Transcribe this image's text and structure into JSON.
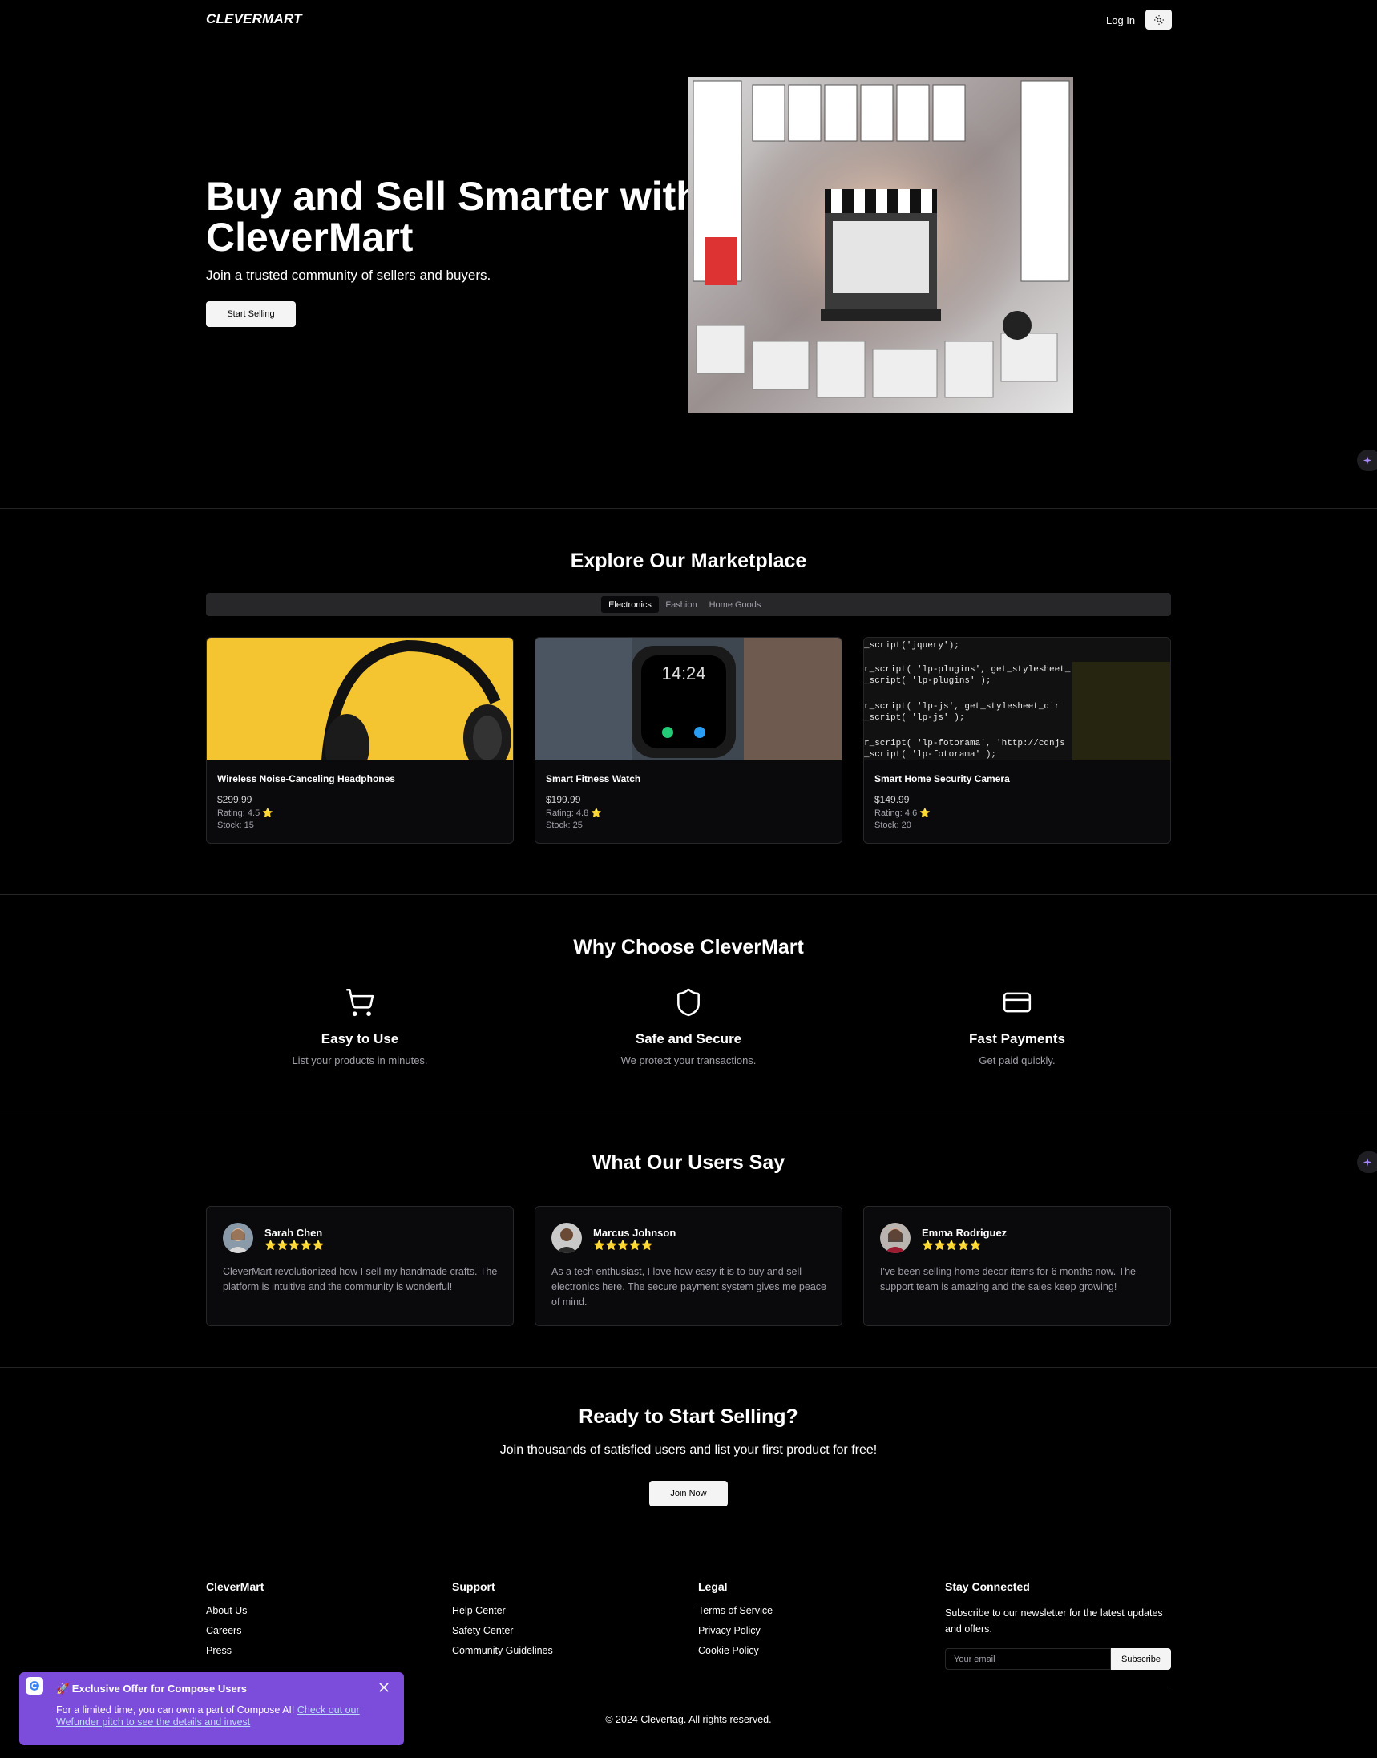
{
  "header": {
    "logo": "CLEVERMART",
    "login_label": "Log In",
    "theme_icon": "moon-sun-icon"
  },
  "hero": {
    "title": "Buy and Sell Smarter with CleverMart",
    "subtitle": "Join a trusted community of sellers and buyers.",
    "cta_label": "Start Selling"
  },
  "marketplace": {
    "title": "Explore Our Marketplace",
    "tabs": [
      {
        "label": "Electronics",
        "active": true
      },
      {
        "label": "Fashion",
        "active": false
      },
      {
        "label": "Home Goods",
        "active": false
      }
    ],
    "products": [
      {
        "name": "Wireless Noise-Canceling Headphones",
        "price": "$299.99",
        "rating": "Rating: 4.5 ⭐",
        "stock": "Stock: 15"
      },
      {
        "name": "Smart Fitness Watch",
        "price": "$199.99",
        "rating": "Rating: 4.8 ⭐",
        "stock": "Stock: 25"
      },
      {
        "name": "Smart Home Security Camera",
        "price": "$149.99",
        "rating": "Rating: 4.6 ⭐",
        "stock": "Stock: 20"
      }
    ]
  },
  "why": {
    "title": "Why Choose CleverMart",
    "features": [
      {
        "icon": "shopping-cart-icon",
        "title": "Easy to Use",
        "desc": "List your products in minutes."
      },
      {
        "icon": "shield-icon",
        "title": "Safe and Secure",
        "desc": "We protect your transactions."
      },
      {
        "icon": "credit-card-icon",
        "title": "Fast Payments",
        "desc": "Get paid quickly."
      }
    ]
  },
  "testimonials": {
    "title": "What Our Users Say",
    "items": [
      {
        "name": "Sarah Chen",
        "stars": "⭐⭐⭐⭐⭐",
        "text": "CleverMart revolutionized how I sell my handmade crafts. The platform is intuitive and the community is wonderful!"
      },
      {
        "name": "Marcus Johnson",
        "stars": "⭐⭐⭐⭐⭐",
        "text": "As a tech enthusiast, I love how easy it is to buy and sell electronics here. The secure payment system gives me peace of mind."
      },
      {
        "name": "Emma Rodriguez",
        "stars": "⭐⭐⭐⭐⭐",
        "text": "I've been selling home decor items for 6 months now. The support team is amazing and the sales keep growing!"
      }
    ]
  },
  "cta": {
    "title": "Ready to Start Selling?",
    "subtitle": "Join thousands of satisfied users and list your first product for free!",
    "button": "Join Now"
  },
  "footer": {
    "col1": {
      "heading": "CleverMart",
      "links": [
        "About Us",
        "Careers",
        "Press"
      ]
    },
    "col2": {
      "heading": "Support",
      "links": [
        "Help Center",
        "Safety Center",
        "Community Guidelines"
      ]
    },
    "col3": {
      "heading": "Legal",
      "links": [
        "Terms of Service",
        "Privacy Policy",
        "Cookie Policy"
      ]
    },
    "col4": {
      "heading": "Stay Connected",
      "desc": "Subscribe to our newsletter for the latest updates and offers.",
      "email_placeholder": "Your email",
      "button": "Subscribe"
    },
    "copyright": "© 2024 Clevertag. All rights reserved."
  },
  "toast": {
    "title": "🚀 Exclusive Offer for Compose Users",
    "text": "For a limited time, you can own a part of Compose AI! ",
    "link": "Check out our Wefunder pitch to see the details and invest"
  },
  "colors": {
    "background": "#000000",
    "card": "#0a0a0c",
    "border": "#27272a",
    "star": "#facc15",
    "toast": "#7c4ddb"
  }
}
